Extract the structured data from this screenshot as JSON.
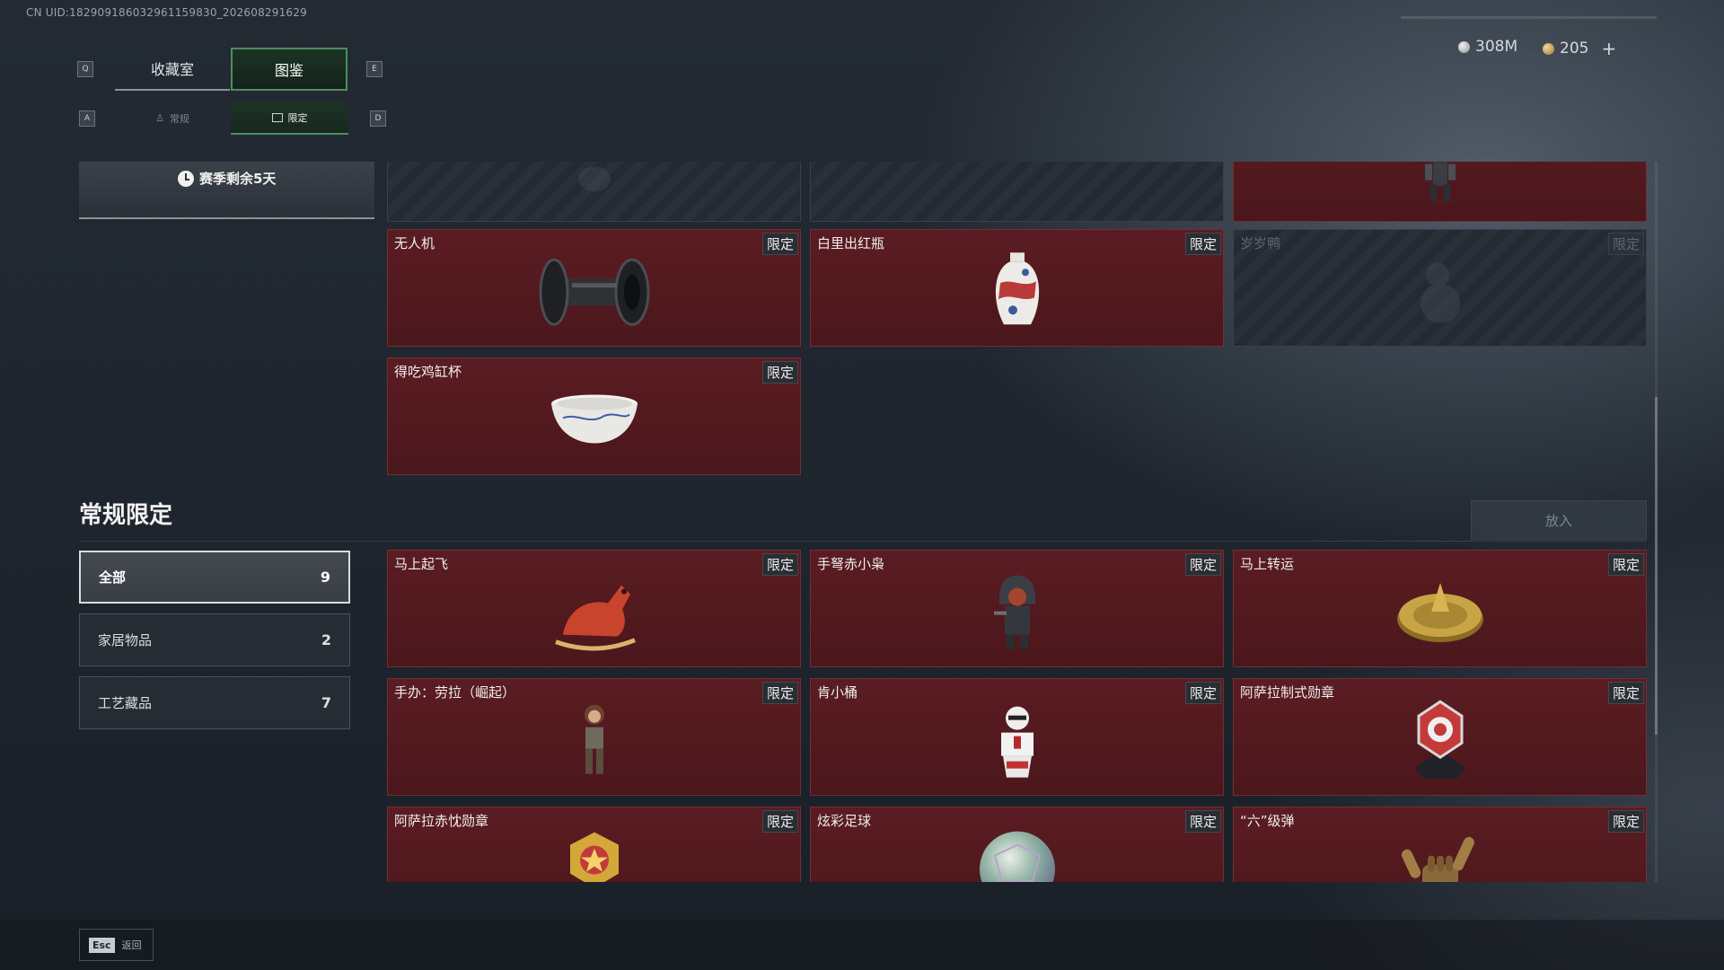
{
  "uid": "CN UID:18290918603296115983​0_202608291629",
  "keys": {
    "q": "Q",
    "e": "E",
    "a": "A",
    "d": "D",
    "esc": "Esc"
  },
  "tabs": {
    "collection": "收藏室",
    "codex": "图鉴"
  },
  "subtabs": {
    "regular": "常规",
    "limited": "限定"
  },
  "currency": {
    "silver": "308M",
    "gold": "205",
    "add": "+"
  },
  "season": {
    "remaining": "赛季剩余5天"
  },
  "top_items": [
    {
      "name": "",
      "tag": "",
      "locked": true
    },
    {
      "name": "",
      "tag": "",
      "locked": true
    },
    {
      "name": "",
      "tag": "",
      "locked": false
    },
    {
      "name": "无人机",
      "tag": "限定",
      "locked": false
    },
    {
      "name": "白里出红瓶",
      "tag": "限定",
      "locked": false
    },
    {
      "name": "岁岁鸭",
      "tag": "限定",
      "locked": true
    },
    {
      "name": "得吃鸡缸杯",
      "tag": "限定",
      "locked": false
    }
  ],
  "section": {
    "title": "常规限定",
    "place_button": "放入"
  },
  "filters": [
    {
      "label": "全部",
      "count": "9"
    },
    {
      "label": "家居物品",
      "count": "2"
    },
    {
      "label": "工艺藏品",
      "count": "7"
    }
  ],
  "items": [
    {
      "name": "马上起飞",
      "tag": "限定"
    },
    {
      "name": "手弩赤小枭",
      "tag": "限定"
    },
    {
      "name": "马上转运",
      "tag": "限定"
    },
    {
      "name": "手办：劳拉（崛起）",
      "tag": "限定"
    },
    {
      "name": "肯小桶",
      "tag": "限定"
    },
    {
      "name": "阿萨拉制式勋章",
      "tag": "限定"
    },
    {
      "name": "阿萨拉赤忱勋章",
      "tag": "限定"
    },
    {
      "name": "炫彩足球",
      "tag": "限定"
    },
    {
      "name": "“六”级弹",
      "tag": "限定"
    }
  ],
  "footer": {
    "back_label": "返回"
  },
  "colors": {
    "card_bg": "#5a1c22",
    "accent_green": "#4c8e60",
    "tag_bg": "#2a2d31"
  }
}
